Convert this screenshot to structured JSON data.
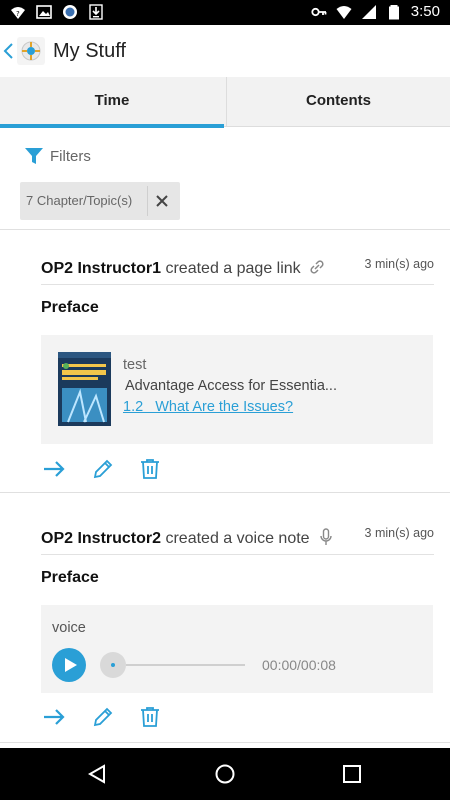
{
  "status_bar": {
    "time": "3:50",
    "left_icons": [
      "wifi-question-icon",
      "image-icon",
      "shield-icon",
      "download-icon"
    ],
    "right_icons": [
      "key-icon",
      "wifi-icon",
      "signal-icon",
      "battery-icon"
    ]
  },
  "app_bar": {
    "title": "My Stuff"
  },
  "tabs": [
    {
      "label": "Time",
      "active": true
    },
    {
      "label": "Contents",
      "active": false
    }
  ],
  "filters": {
    "label": "Filters",
    "chip_label": "7 Chapter/Topic(s)"
  },
  "colors": {
    "accent": "#2a9fd6",
    "divider": "#e0e0e0",
    "panel": "#f3f3f3"
  },
  "cards": [
    {
      "author": "OP2 Instructor1",
      "action": " created a page link",
      "type_icon": "link-icon",
      "time": "3 min(s) ago",
      "chapter": "Preface",
      "link": {
        "title": "test",
        "book": "Advantage Access for Essentia...",
        "ref": "1.2   What Are the Issues?"
      }
    },
    {
      "author": "OP2 Instructor2",
      "action": " created a voice note",
      "type_icon": "microphone-icon",
      "time": "3 min(s) ago",
      "chapter": "Preface",
      "voice": {
        "label": "voice",
        "time": "00:00/00:08"
      }
    }
  ],
  "nav_bar": [
    "back-icon",
    "home-icon",
    "recents-icon"
  ]
}
